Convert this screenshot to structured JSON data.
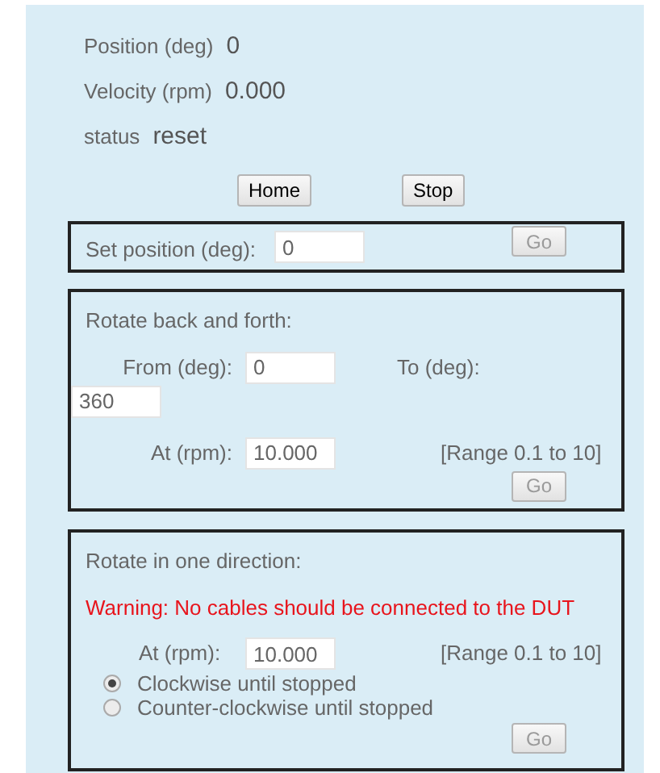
{
  "readouts": [
    {
      "label": "Position (deg)",
      "value": "0"
    },
    {
      "label": "Velocity (rpm)",
      "value": "0.000"
    },
    {
      "label": "status",
      "value": "reset"
    }
  ],
  "buttons": [
    {
      "label": "Home",
      "disabled": false
    },
    {
      "label": "Stop",
      "disabled": false
    }
  ],
  "set_position": {
    "label": "Set position (deg):",
    "value": "0",
    "go": {
      "label": "Go",
      "disabled": true
    }
  },
  "back_and_forth": {
    "title": "Rotate back and forth:",
    "from_label": "From (deg):",
    "from_value": "0",
    "to_label": "To (deg):",
    "to_value": "360",
    "at_label": "At (rpm):",
    "at_value": "10.000",
    "range": "[Range 0.1 to 10]",
    "go": {
      "label": "Go",
      "disabled": true
    }
  },
  "one_direction": {
    "title": "Rotate in one direction:",
    "warning": "Warning: No cables should be connected to the DUT",
    "at_label": "At (rpm):",
    "at_value": "10.000",
    "range": "[Range 0.1 to 10]",
    "options": [
      {
        "label": "Clockwise until stopped",
        "selected": true
      },
      {
        "label": "Counter-clockwise until stopped",
        "selected": false
      }
    ],
    "go": {
      "label": "Go",
      "disabled": true
    }
  }
}
